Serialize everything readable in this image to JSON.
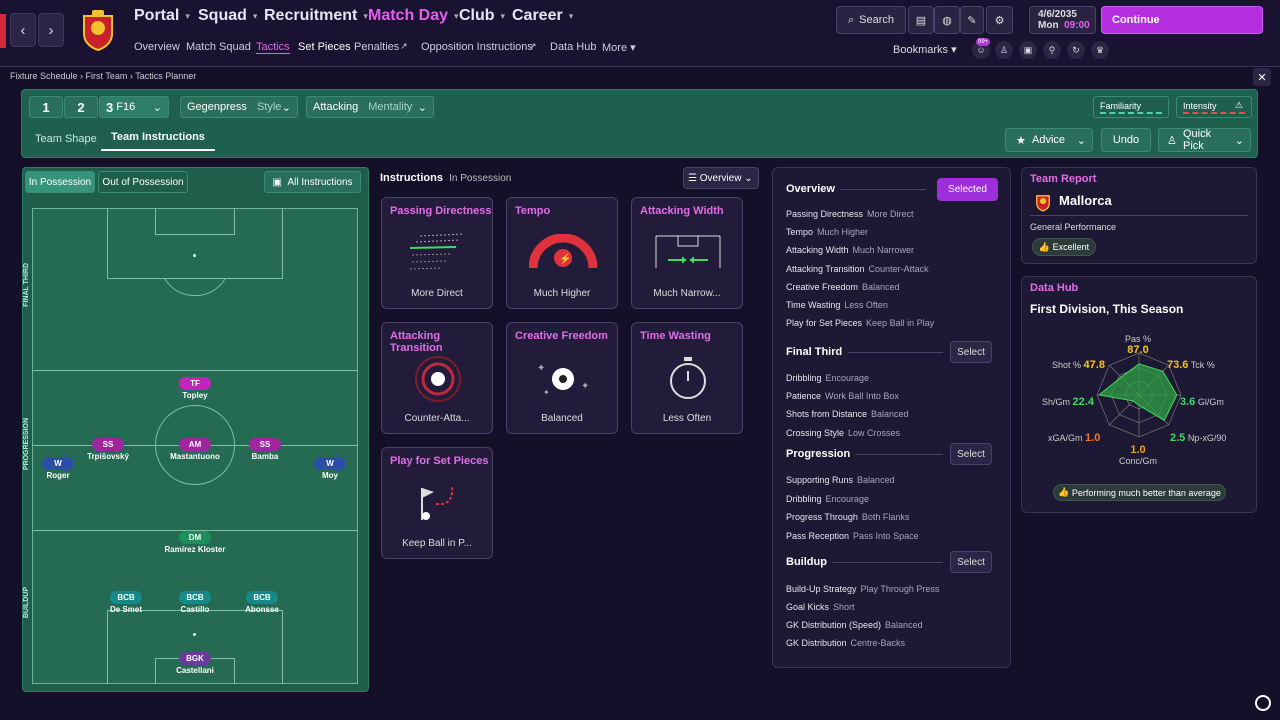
{
  "top": {
    "nav": [
      "Portal",
      "Squad",
      "Recruitment",
      "Match Day",
      "Club",
      "Career"
    ],
    "subnav": [
      "Overview",
      "Match Squad",
      "Tactics",
      "Set Pieces",
      "Penalties",
      "Opposition Instructions",
      "Data Hub",
      "More"
    ],
    "search": "Search",
    "date": "4/6/2035",
    "day": "Mon",
    "time": "09:00",
    "continue": "Continue",
    "bookmarks": "Bookmarks",
    "badge_count": "99+"
  },
  "breadcrumb": [
    "Fixture Schedule",
    "First Team",
    "Tactics Planner"
  ],
  "tactics": {
    "slots": [
      "1",
      "2",
      "3"
    ],
    "slot3_name": "F16",
    "style_value": "Gegenpress",
    "style_label": "Style",
    "mentality_value": "Attacking",
    "mentality_label": "Mentality",
    "familiarity": "Familiarity",
    "intensity": "Intensity",
    "tabs": [
      "Team Shape",
      "Team Instructions"
    ],
    "advice": "Advice",
    "undo": "Undo",
    "quick_pick": "Quick Pick"
  },
  "pitch": {
    "tabs": [
      "In Possession",
      "Out of Possession"
    ],
    "all_instructions": "All Instructions",
    "zones": [
      "FINAL THIRD",
      "PROGRESSION",
      "BUILDUP"
    ],
    "players": [
      {
        "role": "TF",
        "name": "Topley",
        "color": "#c026b8"
      },
      {
        "role": "SS",
        "name": "Trpišovský",
        "color": "#a0259f"
      },
      {
        "role": "AM",
        "name": "Mastantuono",
        "color": "#a0259f"
      },
      {
        "role": "SS",
        "name": "Bamba",
        "color": "#a0259f"
      },
      {
        "role": "W",
        "name": "Roger",
        "color": "#2b4fa8"
      },
      {
        "role": "W",
        "name": "Moy",
        "color": "#2b4fa8"
      },
      {
        "role": "DM",
        "name": "Ramírez Kloster",
        "color": "#1e8f5a"
      },
      {
        "role": "BCB",
        "name": "De Smet",
        "color": "#168a8a"
      },
      {
        "role": "BCB",
        "name": "Castillo",
        "color": "#168a8a"
      },
      {
        "role": "BCB",
        "name": "Abonsse",
        "color": "#168a8a"
      },
      {
        "role": "BGK",
        "name": "Castellani",
        "color": "#6b3a9c"
      }
    ]
  },
  "instructions": {
    "title": "Instructions",
    "subtitle": "In Possession",
    "view": "Overview",
    "cards": [
      {
        "title": "Passing Directness",
        "value": "More Direct"
      },
      {
        "title": "Tempo",
        "value": "Much Higher"
      },
      {
        "title": "Attacking Width",
        "value": "Much Narrow..."
      },
      {
        "title": "Attacking Transition",
        "value": "Counter-Atta..."
      },
      {
        "title": "Creative Freedom",
        "value": "Balanced"
      },
      {
        "title": "Time Wasting",
        "value": "Less Often"
      },
      {
        "title": "Play for Set Pieces",
        "value": "Keep Ball in P..."
      }
    ]
  },
  "overview": {
    "title": "Overview",
    "selected": "Selected",
    "rows": [
      {
        "k": "Passing Directness",
        "v": "More Direct"
      },
      {
        "k": "Tempo",
        "v": "Much Higher"
      },
      {
        "k": "Attacking Width",
        "v": "Much Narrower"
      },
      {
        "k": "Attacking Transition",
        "v": "Counter-Attack"
      },
      {
        "k": "Creative Freedom",
        "v": "Balanced"
      },
      {
        "k": "Time Wasting",
        "v": "Less Often"
      },
      {
        "k": "Play for Set Pieces",
        "v": "Keep Ball in Play"
      }
    ],
    "select": "Select",
    "final_third": {
      "title": "Final Third",
      "rows": [
        {
          "k": "Dribbling",
          "v": "Encourage"
        },
        {
          "k": "Patience",
          "v": "Work Ball Into Box"
        },
        {
          "k": "Shots from Distance",
          "v": "Balanced"
        },
        {
          "k": "Crossing Style",
          "v": "Low Crosses"
        }
      ]
    },
    "progression": {
      "title": "Progression",
      "rows": [
        {
          "k": "Supporting Runs",
          "v": "Balanced"
        },
        {
          "k": "Dribbling",
          "v": "Encourage"
        },
        {
          "k": "Progress Through",
          "v": "Both Flanks"
        },
        {
          "k": "Pass Reception",
          "v": "Pass Into Space"
        }
      ]
    },
    "buildup": {
      "title": "Buildup",
      "rows": [
        {
          "k": "Build-Up Strategy",
          "v": "Play Through Press"
        },
        {
          "k": "Goal Kicks",
          "v": "Short"
        },
        {
          "k": "GK Distribution (Speed)",
          "v": "Balanced"
        },
        {
          "k": "GK Distribution",
          "v": "Centre-Backs"
        }
      ]
    }
  },
  "report": {
    "title": "Team Report",
    "team": "Mallorca",
    "perf_label": "General Performance",
    "perf_value": "Excellent"
  },
  "datahub": {
    "title": "Data Hub",
    "subtitle": "First Division, This Season",
    "stats": [
      {
        "label": "Pas %",
        "value": "87.0",
        "color": "#f5c518"
      },
      {
        "label": "Tck %",
        "value": "73.6",
        "color": "#f5c518"
      },
      {
        "label": "Gl/Gm",
        "value": "3.6",
        "color": "#3ddc5c"
      },
      {
        "label": "Np-xG/90",
        "value": "2.5",
        "color": "#3ddc5c"
      },
      {
        "label": "Conc/Gm",
        "value": "1.0",
        "color": "#f59e1b"
      },
      {
        "label": "xGA/Gm",
        "value": "1.0",
        "color": "#f5762a"
      },
      {
        "label": "Sh/Gm",
        "value": "22.4",
        "color": "#3ddc5c"
      },
      {
        "label": "Shot %",
        "value": "47.8",
        "color": "#f5c518"
      }
    ],
    "radar": [
      0.74,
      0.8,
      0.9,
      0.85,
      0.25,
      0.2,
      0.95,
      0.6
    ],
    "footer": "Performing much better than average"
  }
}
